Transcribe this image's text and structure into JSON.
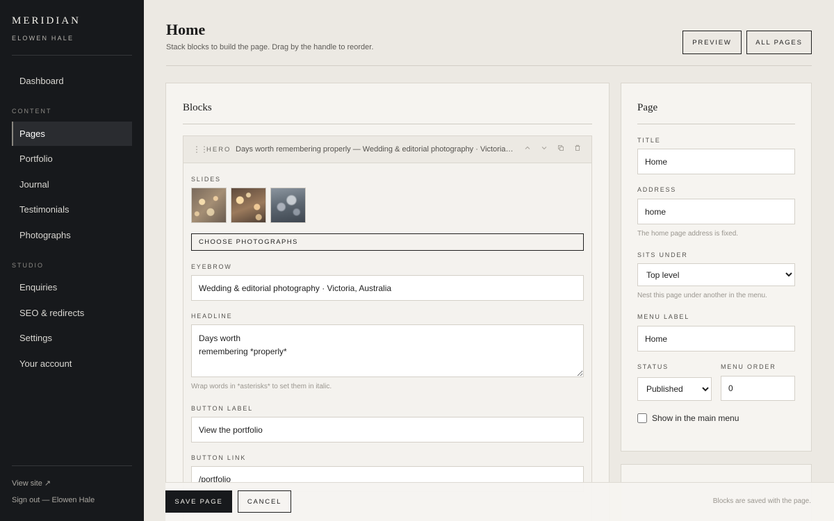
{
  "sidebar": {
    "brand": "MERIDIAN",
    "owner": "ELOWEN HALE",
    "dashboard": "Dashboard",
    "content_heading": "CONTENT",
    "content_items": [
      "Pages",
      "Portfolio",
      "Journal",
      "Testimonials",
      "Photographs"
    ],
    "active_item": "Pages",
    "studio_heading": "STUDIO",
    "studio_items": [
      "Enquiries",
      "SEO & redirects",
      "Settings",
      "Your account"
    ],
    "view_site": "View site ↗",
    "sign_out": "Sign out — Elowen Hale"
  },
  "header": {
    "title": "Home",
    "subtitle": "Stack blocks to build the page. Drag by the handle to reorder.",
    "preview_label": "PREVIEW",
    "all_pages_label": "ALL PAGES"
  },
  "blocks_panel": {
    "title": "Blocks",
    "block": {
      "handle_icon": "drag-handle-icon",
      "type": "HERO",
      "summary": "Days worth remembering properly — Wedding & editorial photography · Victoria, Australia",
      "tools": [
        "move-up-icon",
        "move-down-icon",
        "duplicate-icon",
        "delete-icon"
      ],
      "slides_label": "SLIDES",
      "choose_label": "CHOOSE PHOTOGRAPHS",
      "eyebrow_label": "EYEBROW",
      "eyebrow_value": "Wedding & editorial photography · Victoria, Australia",
      "headline_label": "HEADLINE",
      "headline_value": "Days worth\nremembering *properly*",
      "headline_hint": "Wrap words in *asterisks* to set them in italic.",
      "button_label_label": "BUTTON LABEL",
      "button_label_value": "View the portfolio",
      "button_link_label": "BUTTON LINK",
      "button_link_value": "/portfolio"
    }
  },
  "page_panel": {
    "title": "Page",
    "title_label": "TITLE",
    "title_value": "Home",
    "address_label": "ADDRESS",
    "address_value": "home",
    "address_hint": "The home page address is fixed.",
    "sits_under_label": "SITS UNDER",
    "sits_under_value": "Top level",
    "sits_under_hint": "Nest this page under another in the menu.",
    "menu_label_label": "MENU LABEL",
    "menu_label_value": "Home",
    "status_label": "STATUS",
    "status_value": "Published",
    "menu_order_label": "MENU ORDER",
    "menu_order_value": "0",
    "show_in_menu_label": "Show in the main menu",
    "show_in_menu_checked": false
  },
  "footer": {
    "save_label": "SAVE PAGE",
    "cancel_label": "CANCEL",
    "note": "Blocks are saved with the page."
  }
}
